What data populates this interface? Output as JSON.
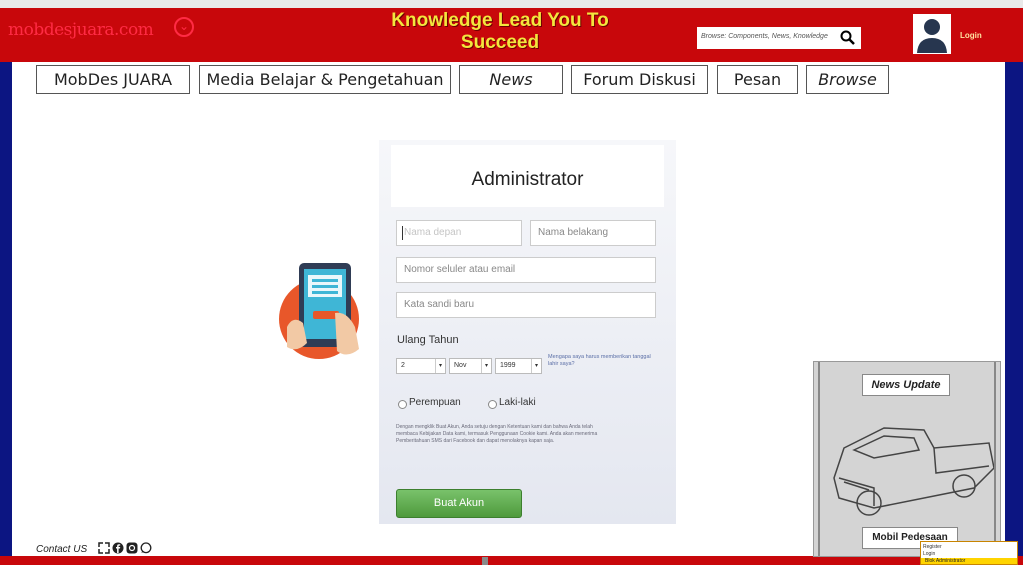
{
  "header": {
    "logo_text": "mobdesjuara.com",
    "tagline": "Knowledge Lead You To Succeed",
    "search_placeholder": "Browse: Components, News, Knowledge",
    "user_label": "Login"
  },
  "nav": {
    "items": [
      {
        "label": "MobDes JUARA"
      },
      {
        "label": "Media Belajar & Pengetahuan"
      },
      {
        "label": "News"
      },
      {
        "label": "Forum Diskusi"
      },
      {
        "label": "Pesan"
      },
      {
        "label": "Browse"
      }
    ]
  },
  "form": {
    "title": "Administrator",
    "first_name_placeholder": "Nama depan",
    "last_name_placeholder": "Nama belakang",
    "contact_placeholder": "Nomor seluler atau email",
    "password_placeholder": "Kata sandi baru",
    "birthday_label": "Ulang Tahun",
    "day": "2",
    "month": "Nov",
    "year": "1999",
    "why_text": "Mengapa saya harus memberikan tanggal lahir saya?",
    "gender_female": "Perempuan",
    "gender_male": "Laki-laki",
    "terms_text": "Dengan mengklik Buat Akun, Anda setuju dengan Ketentuan kami dan bahwa Anda telah membaca Kebijakan Data kami, termasuk Penggunaan Cookie kami. Anda akan menerima Pemberitahuan SMS dari Facebook dan dapat menolaknya kapan saja.",
    "submit_label": "Buat Akun"
  },
  "news": {
    "title": "News Update",
    "caption": "Mobil Pedesaan",
    "popup_items": [
      "Register",
      "Login"
    ],
    "popup_bar": "Blok Administrator"
  },
  "footer": {
    "contact_label": "Contact US"
  },
  "colors": {
    "header_red": "#c8070b",
    "side_blue": "#0c1582",
    "tagline_yellow": "#f3e63d",
    "button_green": "#4e9a3c"
  }
}
